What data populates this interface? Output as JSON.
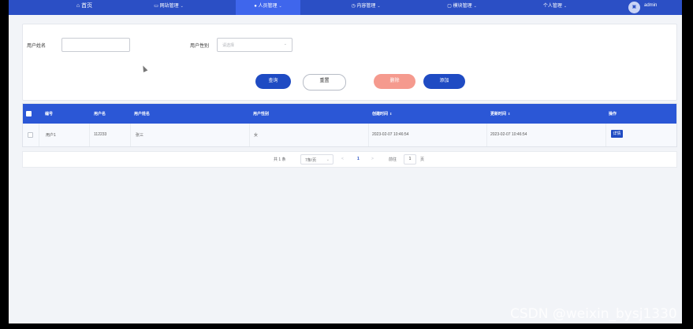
{
  "nav": {
    "home": "首页",
    "items": [
      {
        "label": "网站管理",
        "icon": "monitor-icon"
      },
      {
        "label": "人员管理",
        "icon": "user-icon"
      },
      {
        "label": "内容管理",
        "icon": "clock-icon"
      },
      {
        "label": "模块管理",
        "icon": "copy-icon"
      },
      {
        "label": "个人管理",
        "icon": ""
      }
    ],
    "user": "admin"
  },
  "search": {
    "name_label": "用户姓名",
    "name_value": "",
    "gender_label": "用户性别",
    "gender_placeholder": "请选择",
    "query_button": "查询",
    "reset_button": "重置",
    "delete_button": "删除",
    "add_button": "添加"
  },
  "table": {
    "headers": [
      "编号",
      "用户名",
      "用户姓名",
      "用户性别",
      "创建时间",
      "更新时间",
      "操作"
    ],
    "sort_icon": "⇕",
    "rows": [
      {
        "id": "用户1",
        "username": "112233",
        "realname": "张三",
        "gender": "女",
        "created": "2023-02-07 10:46:54",
        "updated": "2023-02-07 10:46:54",
        "action": "详情"
      }
    ]
  },
  "pagination": {
    "total": "共 1 条",
    "page_size": "7条/页",
    "prev": "<",
    "current": "1",
    "next": ">",
    "goto_label": "前往",
    "goto_value": "1",
    "page_unit": "页"
  },
  "watermark": "CSDN @weixin_bysj1330",
  "colors": {
    "nav_bg": "#2b4fc5",
    "primary": "#1f4bc3",
    "danger_light": "#f59a8e"
  }
}
